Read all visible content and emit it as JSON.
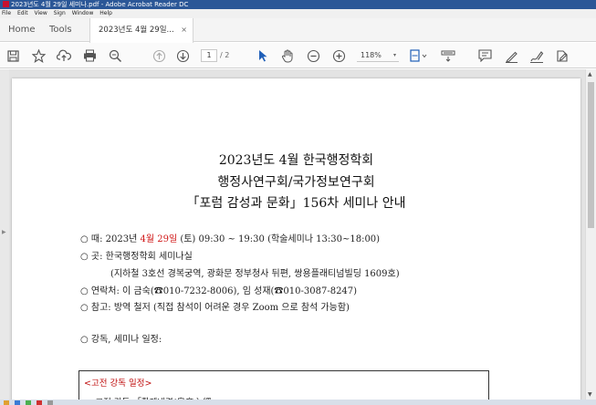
{
  "window": {
    "title": "2023년도 4월 29일 세미나.pdf - Adobe Acrobat Reader DC"
  },
  "menu": {
    "items": [
      "File",
      "Edit",
      "View",
      "Sign",
      "Window",
      "Help"
    ]
  },
  "tabs": {
    "home": "Home",
    "tools": "Tools",
    "doc": "2023년도 4월 29일...",
    "close": "×"
  },
  "toolbar": {
    "page_current": "1",
    "page_total": "/ 2",
    "zoom": "118%",
    "zoom_caret": "▾"
  },
  "document": {
    "title_lines": [
      "2023년도 4월  한국행정학회",
      "행정사연구회/국가정보연구회",
      "「포럼 감성과 문화」156차 세미나 안내"
    ],
    "when": {
      "prefix": "○ 때: 2023년 ",
      "date_red": "4월 29일",
      "suffix": " (토) 09:30 ~ 19:30 (학술세미나  13:30~18:00)"
    },
    "where": "○ 곳: 한국행정학회 세미나실",
    "where_detail": "(지하철 3호선 경복궁역, 광화문 정부청사 뒤편, 쌍용플래티넘빌딩 1609호)",
    "contact": "○ 연락처: 이 금숙(☎010-7232-8006), 임 성재(☎010-3087-8247)",
    "note": "○ 참고: 방역 철저 (직접 참석이 어려운 경우 Zoom 으로 참석 가능함)",
    "schedule": "○ 강독, 세미나 일정:",
    "box": {
      "title": "<고전 강독 일정>",
      "line": "► 고전 강독   「황제내경(皇帝內經"
    }
  },
  "colors": {
    "accent_red": "#d01818",
    "titlebar_blue": "#2b5797"
  }
}
